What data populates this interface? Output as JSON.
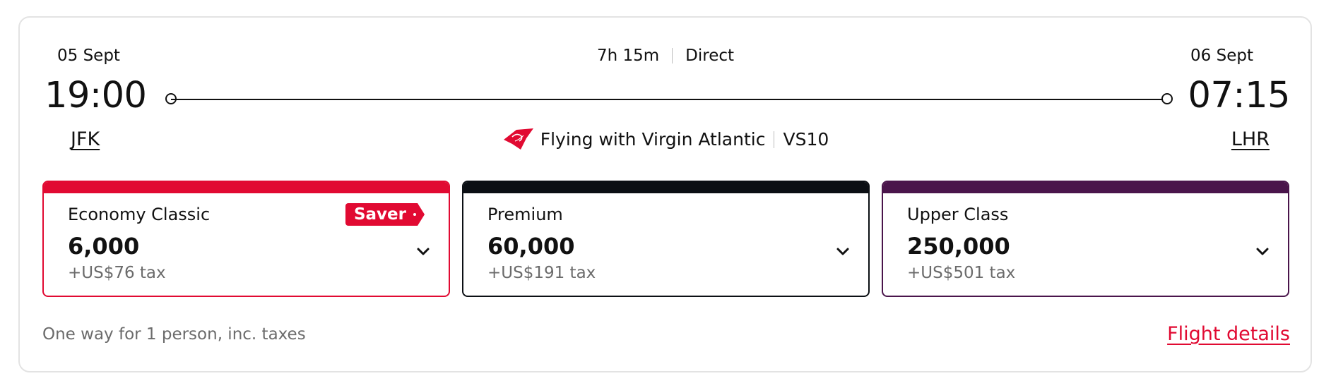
{
  "departure": {
    "date": "05 Sept",
    "time": "19:00",
    "airport": "JFK"
  },
  "arrival": {
    "date": "06 Sept",
    "time": "07:15",
    "airport": "LHR"
  },
  "duration": "7h 15m",
  "stops": "Direct",
  "operator": {
    "text": "Flying with Virgin Atlantic",
    "flight_number": "VS10",
    "logo_icon": "virgin-tail-icon"
  },
  "fares": [
    {
      "cabin": "Economy Classic",
      "points": "6,000",
      "tax": "+US$76 tax",
      "badge": "Saver",
      "color": "#e10a32"
    },
    {
      "cabin": "Premium",
      "points": "60,000",
      "tax": "+US$191 tax",
      "color": "#0b0f14"
    },
    {
      "cabin": "Upper Class",
      "points": "250,000",
      "tax": "+US$501 tax",
      "color": "#4a154b"
    }
  ],
  "footer": {
    "note": "One way for 1 person, inc. taxes",
    "details_link": "Flight details"
  }
}
